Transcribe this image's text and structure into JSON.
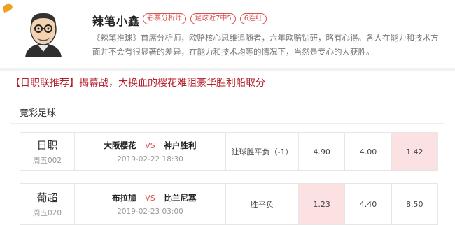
{
  "profile": {
    "name": "辣笔小鑫",
    "tags": [
      "彩票分析师",
      "足球近7中5",
      "6连红"
    ],
    "bio": "《辣笔推球》首席分析师，欧赔核心思维追随者，六年欧赔钻研，略有心得。各人在能力和技术方面并不会有很显著的差异，在能力和技术均等的情况下，当然是专心的人获胜。"
  },
  "headline": "【日职联推荐】揭幕战，大换血的樱花难阻豪华胜利船取分",
  "section_title": "竞彩足球",
  "matches": [
    {
      "league": "日职",
      "match_no": "周五002",
      "home": "大阪樱花",
      "vs": "VS",
      "away": "神户胜利",
      "time": "2019-02-22 18:30",
      "bet_type": "让球胜平负（-1）",
      "odds": [
        "4.90",
        "4.00",
        "1.42"
      ],
      "highlight_index": 2
    },
    {
      "league": "葡超",
      "match_no": "周五020",
      "home": "布拉加",
      "vs": "VS",
      "away": "比兰尼塞",
      "time": "2019-02-23 03:00",
      "bet_type": "胜平负",
      "odds": [
        "1.23",
        "4.40",
        "8.50"
      ],
      "highlight_index": 0
    }
  ],
  "colors": {
    "accent": "#d9534f",
    "headline": "#b4202a",
    "highlight": "#fbe1e2"
  }
}
